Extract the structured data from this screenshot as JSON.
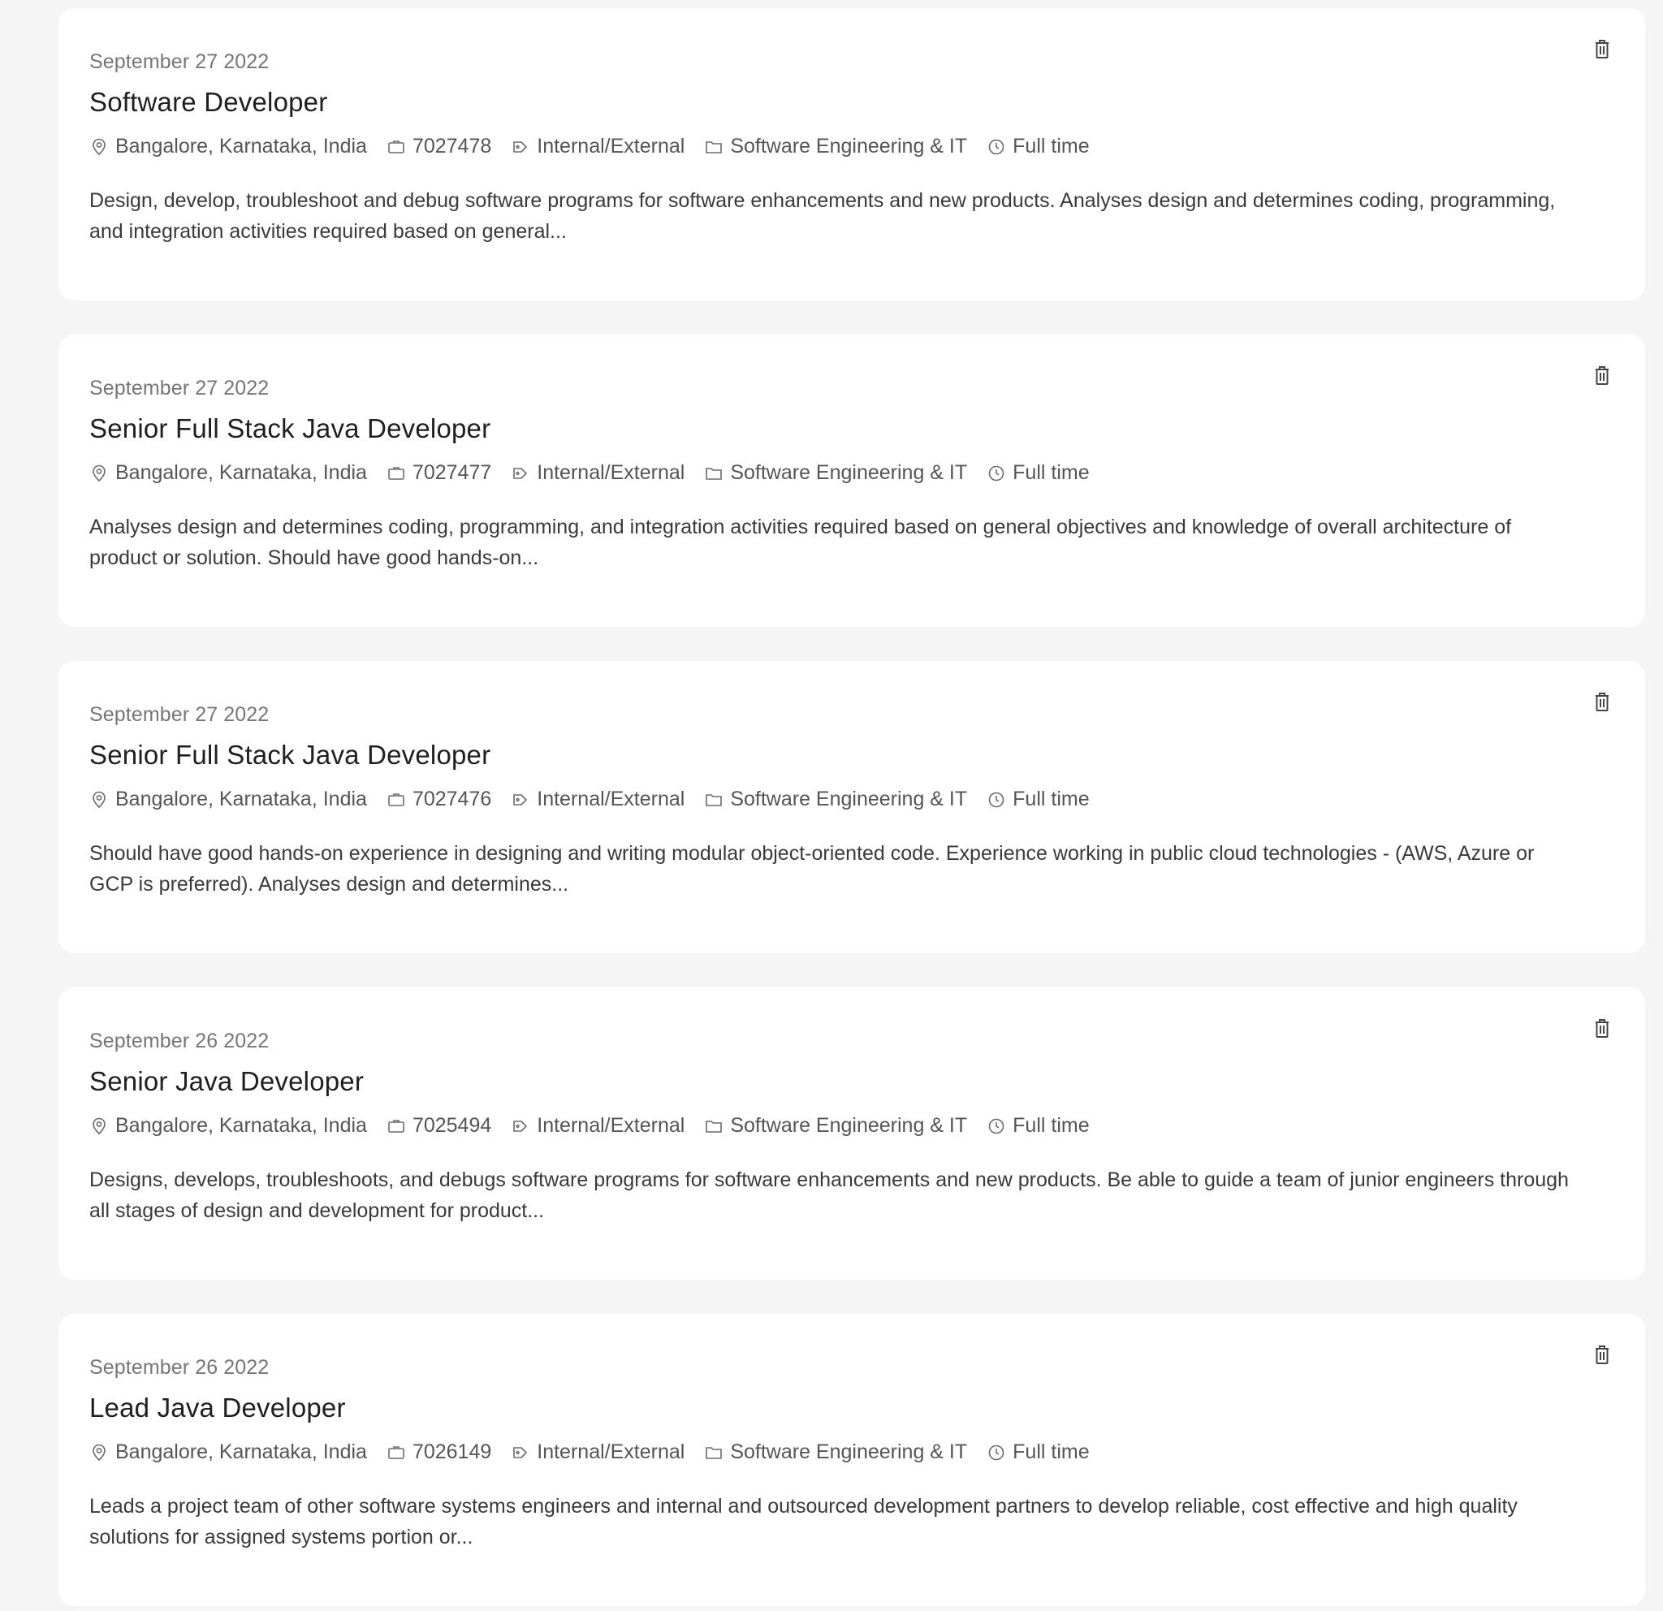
{
  "jobs": [
    {
      "date": "September 27 2022",
      "title": "Software Developer",
      "location": "Bangalore, Karnataka, India",
      "job_id": "7027478",
      "posting_type": "Internal/External",
      "category": "Software Engineering & IT",
      "employment_type": "Full time",
      "description": "Design, develop, troubleshoot and debug software programs for software enhancements and new products. Analyses design and determines coding, programming, and integration activities required based on general..."
    },
    {
      "date": "September 27 2022",
      "title": "Senior Full Stack Java Developer",
      "location": "Bangalore, Karnataka, India",
      "job_id": "7027477",
      "posting_type": "Internal/External",
      "category": "Software Engineering & IT",
      "employment_type": "Full time",
      "description": "Analyses design and determines coding, programming, and integration activities required based on general objectives and knowledge of overall architecture of product or solution. Should have good hands-on..."
    },
    {
      "date": "September 27 2022",
      "title": "Senior Full Stack Java Developer",
      "location": "Bangalore, Karnataka, India",
      "job_id": "7027476",
      "posting_type": "Internal/External",
      "category": "Software Engineering & IT",
      "employment_type": "Full time",
      "description": "Should have good hands-on experience in designing and writing modular object-oriented code. Experience working in public cloud technologies - (AWS, Azure or GCP is preferred). Analyses design and determines..."
    },
    {
      "date": "September 26 2022",
      "title": "Senior Java Developer",
      "location": "Bangalore, Karnataka, India",
      "job_id": "7025494",
      "posting_type": "Internal/External",
      "category": "Software Engineering & IT",
      "employment_type": "Full time",
      "description": "Designs, develops, troubleshoots, and debugs software programs for software enhancements and new products. Be able to guide a team of junior engineers through all stages of design and development for product..."
    },
    {
      "date": "September 26 2022",
      "title": "Lead Java Developer",
      "location": "Bangalore, Karnataka, India",
      "job_id": "7026149",
      "posting_type": "Internal/External",
      "category": "Software Engineering & IT",
      "employment_type": "Full time",
      "description": "Leads a project team of other software systems engineers and internal and outsourced development partners to develop reliable, cost effective and high quality solutions for assigned systems portion or..."
    }
  ],
  "icons": {
    "location": "location-pin-icon",
    "job_id": "briefcase-icon",
    "posting_type": "tag-icon",
    "category": "folder-icon",
    "employment_type": "clock-icon",
    "delete": "trash-icon"
  }
}
